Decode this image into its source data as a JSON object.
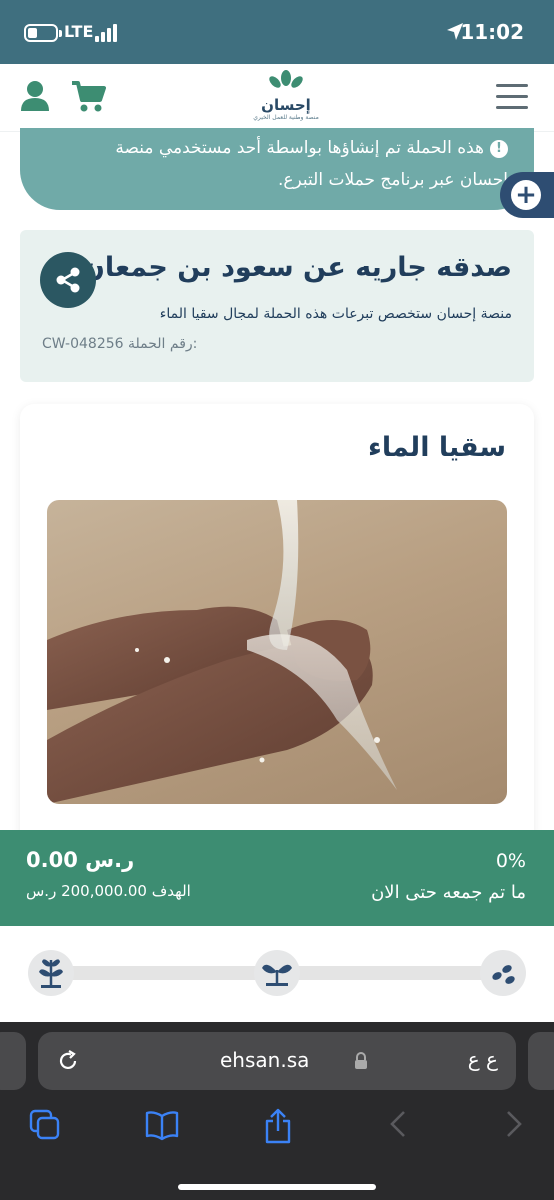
{
  "status_bar": {
    "network": "LTE",
    "time": "11:02",
    "icons": [
      "battery-icon",
      "signal-icon",
      "location-arrow-icon"
    ]
  },
  "header": {
    "logo_text": "إحسان",
    "logo_subtitle": "منصة وطنية للعمل الخيري",
    "icons": [
      "user-icon",
      "cart-icon",
      "menu-icon"
    ]
  },
  "notice": {
    "line1": "هذه الحملة تم إنشاؤها بواسطة أحد مستخدمي منصة",
    "line2": "احسان عبر برنامج حملات التبرع."
  },
  "campaign": {
    "title": "صدقه جاريه عن سعود بن جمعان",
    "description": "منصة إحسان ستخصص تبرعات هذه الحملة لمجال سقيا الماء",
    "id_label": "رقم الحملة:",
    "id_value": "CW-048256"
  },
  "category": {
    "title": "سقيا الماء"
  },
  "progress": {
    "raised_amount": "0.00 ر.س",
    "goal_text": "الهدف 200,000.00 ر.س",
    "percent": "0%",
    "raised_label": "ما تم جمعه حتى الان",
    "fraction": 0
  },
  "stages": [
    "seeds-icon",
    "sprout-icon",
    "plant-icon"
  ],
  "browser": {
    "url": "ehsan.sa",
    "reader_label": "ع ع",
    "toolbar": [
      "tabs-icon",
      "bookmarks-icon",
      "share-icon",
      "back-icon",
      "forward-icon"
    ]
  },
  "colors": {
    "status_bar": "#3f6f7f",
    "notice": "#70aaa8",
    "campaign_card": "#e8f1ef",
    "progress_band": "#3d8d72",
    "primary_text": "#213e5c",
    "brand_green": "#3d8d72"
  }
}
